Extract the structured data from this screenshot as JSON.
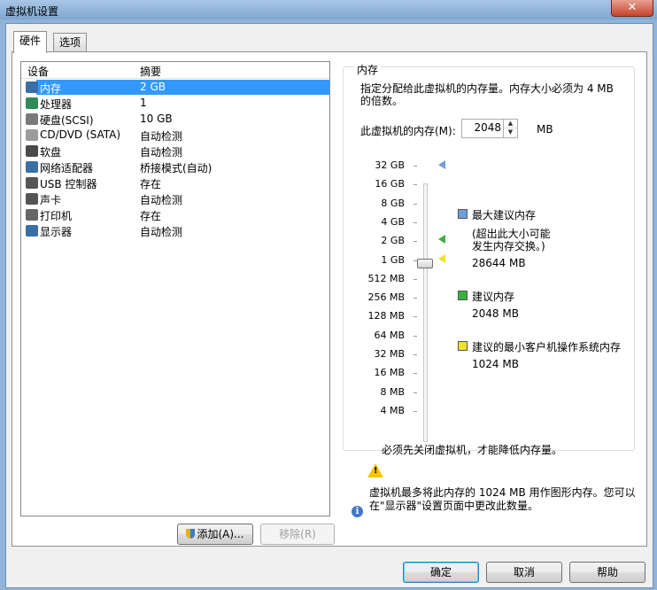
{
  "window": {
    "title": "虚拟机设置",
    "close_glyph": "✕"
  },
  "tabs": [
    {
      "label": "硬件"
    },
    {
      "label": "选项"
    }
  ],
  "devices": {
    "header": {
      "device": "设备",
      "summary": "摘要"
    },
    "items": [
      {
        "name": "内存",
        "summary": "2 GB",
        "icon": "memory-icon",
        "color": "#3a6ea5"
      },
      {
        "name": "处理器",
        "summary": "1",
        "icon": "processor-icon",
        "color": "#2e8b57"
      },
      {
        "name": "硬盘(SCSI)",
        "summary": "10 GB",
        "icon": "harddisk-icon",
        "color": "#7a7a7a"
      },
      {
        "name": "CD/DVD (SATA)",
        "summary": "自动检测",
        "icon": "cd-dvd-icon",
        "color": "#9c9c9c"
      },
      {
        "name": "软盘",
        "summary": "自动检测",
        "icon": "floppy-icon",
        "color": "#4a4a4a"
      },
      {
        "name": "网络适配器",
        "summary": "桥接模式(自动)",
        "icon": "network-adapter-icon",
        "color": "#3a6ea5"
      },
      {
        "name": "USB 控制器",
        "summary": "存在",
        "icon": "usb-icon",
        "color": "#555555"
      },
      {
        "name": "声卡",
        "summary": "自动检测",
        "icon": "sound-card-icon",
        "color": "#555555"
      },
      {
        "name": "打印机",
        "summary": "存在",
        "icon": "printer-icon",
        "color": "#666666"
      },
      {
        "name": "显示器",
        "summary": "自动检测",
        "icon": "display-icon",
        "color": "#3a6ea5"
      }
    ],
    "add_label": "添加(A)...",
    "remove_label": "移除(R)"
  },
  "memory": {
    "group_title": "内存",
    "description": "指定分配给此虚拟机的内存量。内存大小必须为 4 MB",
    "description2": "的倍数。",
    "field_label": "此虚拟机的内存(M):",
    "value": "2048",
    "unit": "MB",
    "scale": [
      "32 GB",
      "16 GB",
      "8 GB",
      "4 GB",
      "2 GB",
      "1 GB",
      "512 MB",
      "256 MB",
      "128 MB",
      "64 MB",
      "32 MB",
      "16 MB",
      "8 MB",
      "4 MB"
    ],
    "legend": {
      "max_label": "最大建议内存",
      "max_note1": "(超出此大小可能",
      "max_note2": "发生内存交换。)",
      "max_value": "28644 MB",
      "rec_label": "建议内存",
      "rec_value": "2048 MB",
      "min_label": "建议的最小客户机操作系统内存",
      "min_value": "1024 MB"
    },
    "colors": {
      "max": "#6f9fd8",
      "rec": "#3cb043",
      "min": "#f0e030"
    },
    "warning": "必须先关闭虚拟机，才能降低内存量。",
    "info1": "虚拟机最多将此内存的 1024 MB 用作图形内存。您可以",
    "info2": "在\"显示器\"设置页面中更改此数量。"
  },
  "buttons": {
    "ok": "确定",
    "cancel": "取消",
    "help": "帮助"
  }
}
